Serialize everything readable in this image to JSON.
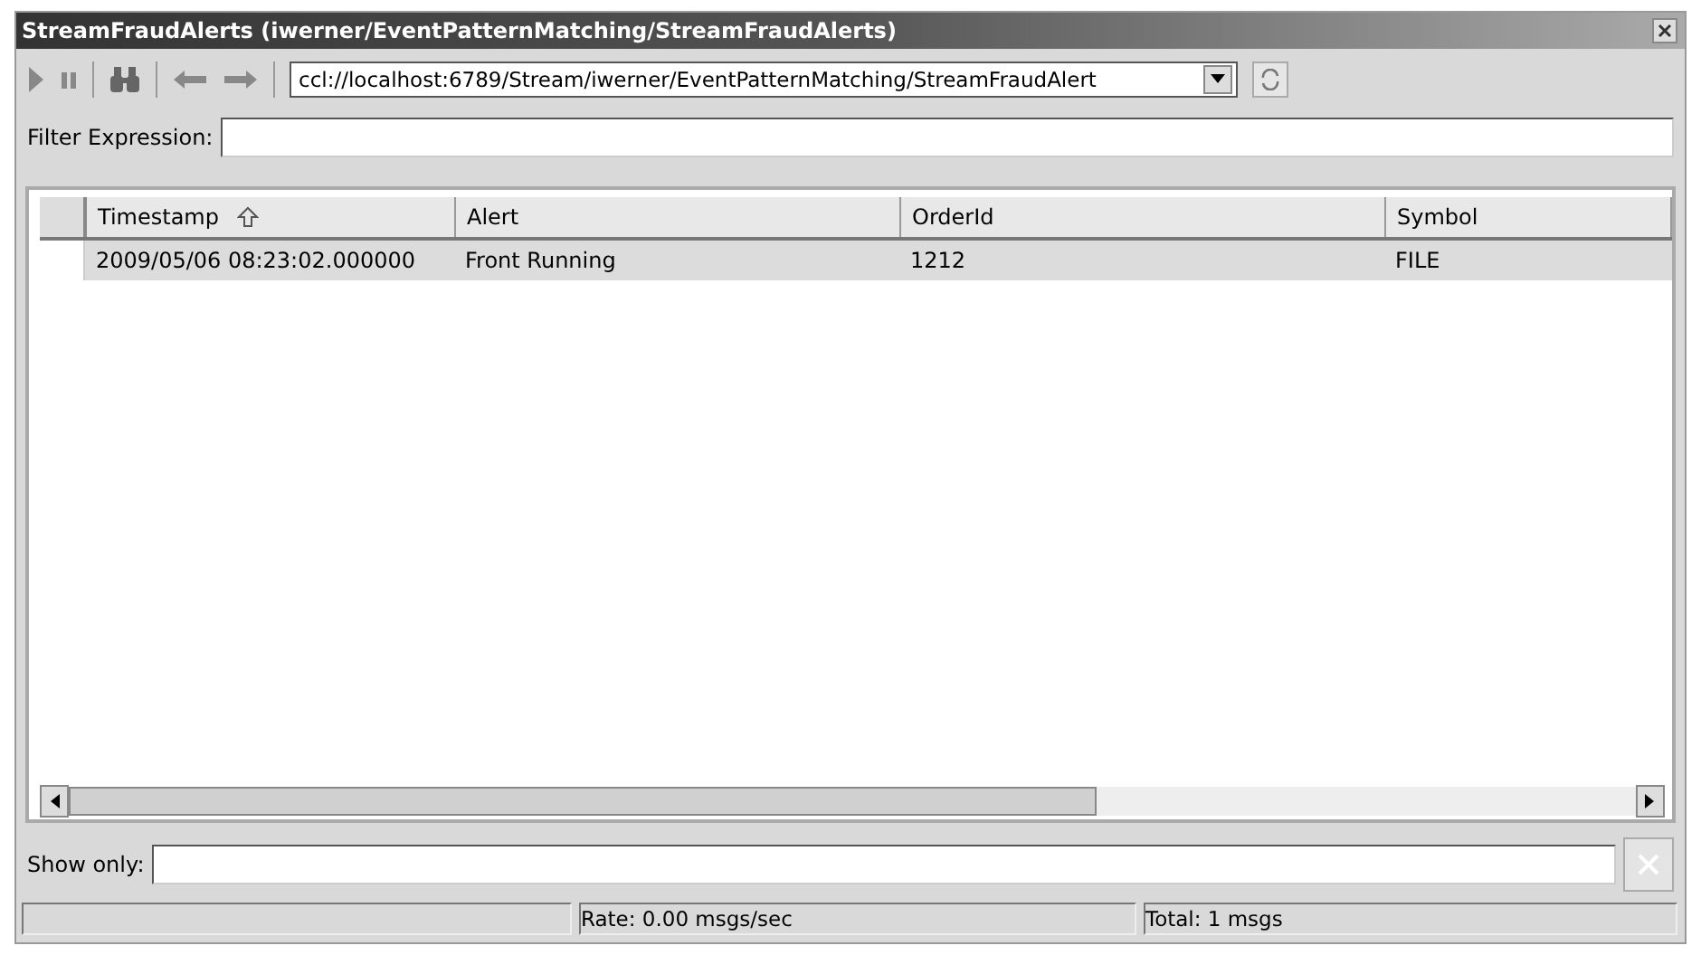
{
  "window": {
    "title": "StreamFraudAlerts (iwerner/EventPatternMatching/StreamFraudAlerts)"
  },
  "toolbar": {
    "url": "ccl://localhost:6789/Stream/iwerner/EventPatternMatching/StreamFraudAlert"
  },
  "filter": {
    "label": "Filter Expression:"
  },
  "table": {
    "columns": [
      {
        "label": "Timestamp",
        "sorted": true
      },
      {
        "label": "Alert",
        "sorted": false
      },
      {
        "label": "OrderId",
        "sorted": false
      },
      {
        "label": "Symbol",
        "sorted": false
      }
    ],
    "rows": [
      {
        "cells": [
          "2009/05/06 08:23:02.000000",
          "Front Running",
          "1212",
          "FILE"
        ],
        "selected": true
      }
    ]
  },
  "show_only": {
    "label": "Show only:"
  },
  "status_bar": {
    "rate": "Rate: 0.00 msgs/sec",
    "total": "Total: 1 msgs"
  }
}
